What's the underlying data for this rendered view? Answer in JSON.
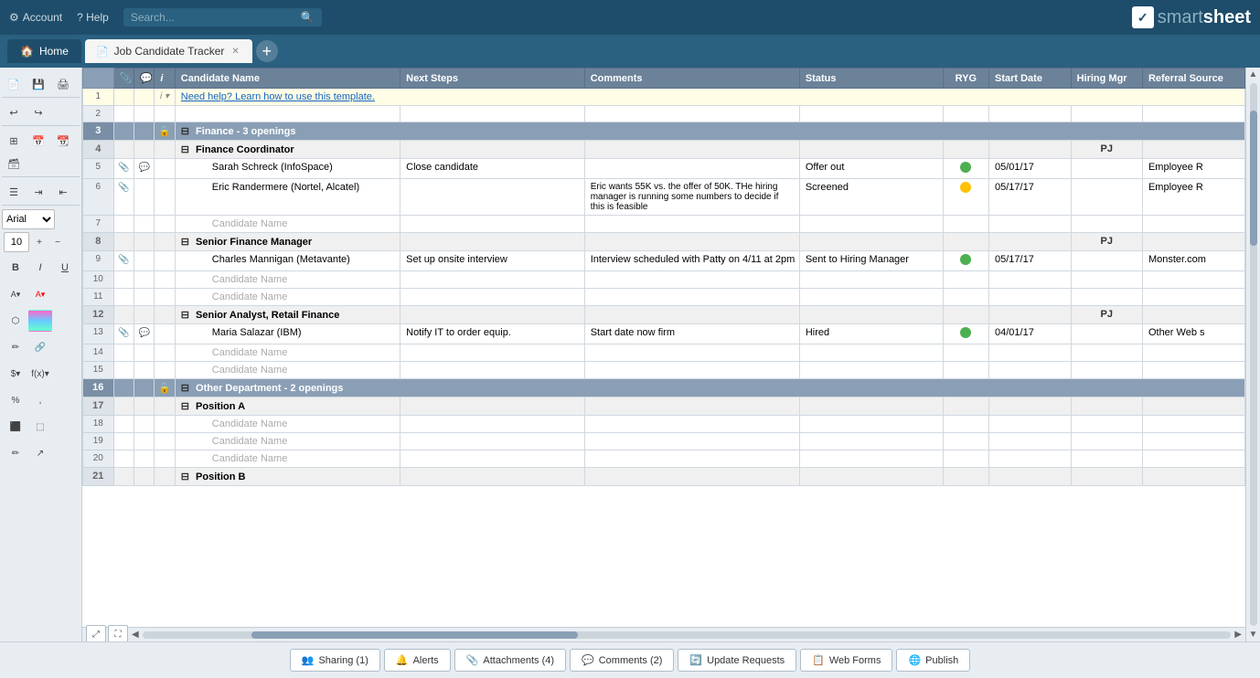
{
  "topnav": {
    "account_label": "Account",
    "help_label": "? Help",
    "search_placeholder": "Search...",
    "logo_smart": "smart",
    "logo_sheet": "sheet"
  },
  "tabs": {
    "home_label": "Home",
    "sheet_label": "Job Candidate Tracker",
    "add_label": "+"
  },
  "columns": {
    "candidate_name": "Candidate Name",
    "next_steps": "Next Steps",
    "comments": "Comments",
    "status": "Status",
    "ryg": "RYG",
    "start_date": "Start Date",
    "hiring_mgr": "Hiring Mgr",
    "referral_source": "Referral Source"
  },
  "info_bar": {
    "text": "Need help? Learn how to use this template."
  },
  "rows": [
    {
      "num": 1,
      "type": "info"
    },
    {
      "num": 2,
      "type": "empty"
    },
    {
      "num": 3,
      "type": "section",
      "has_lock": true,
      "label": "Finance - 3 openings"
    },
    {
      "num": 4,
      "type": "subsection",
      "label": "Finance Coordinator",
      "pj": "PJ"
    },
    {
      "num": 5,
      "type": "data",
      "has_attach": true,
      "has_comment": true,
      "candidate": "Sarah Schreck (InfoSpace)",
      "next_steps": "Close candidate",
      "comments": "",
      "status": "Offer out",
      "ryg": "green",
      "start_date": "05/01/17",
      "hiring_mgr": "",
      "referral": "Employee R"
    },
    {
      "num": 6,
      "type": "data",
      "has_attach": true,
      "has_comment": false,
      "candidate": "Eric Randermere (Nortel, Alcatel)",
      "next_steps": "",
      "comments": "Eric wants 55K vs. the offer of 50K. THe hiring manager is running some numbers to decide if this is feasible",
      "status": "Screened",
      "ryg": "yellow",
      "start_date": "05/17/17",
      "hiring_mgr": "",
      "referral": "Employee R"
    },
    {
      "num": 7,
      "type": "data",
      "has_attach": false,
      "has_comment": false,
      "candidate": "Candidate Name",
      "next_steps": "",
      "comments": "",
      "status": "",
      "ryg": "",
      "start_date": "",
      "hiring_mgr": "",
      "referral": ""
    },
    {
      "num": 8,
      "type": "subsection",
      "label": "Senior Finance Manager",
      "pj": "PJ"
    },
    {
      "num": 9,
      "type": "data",
      "has_attach": true,
      "has_comment": false,
      "candidate": "Charles Mannigan (Metavante)",
      "next_steps": "Set up onsite interview",
      "comments": "Interview scheduled with Patty on 4/11 at 2pm",
      "status": "Sent to Hiring Manager",
      "ryg": "green",
      "start_date": "05/17/17",
      "hiring_mgr": "",
      "referral": "Monster.com"
    },
    {
      "num": 10,
      "type": "data",
      "has_attach": false,
      "has_comment": false,
      "candidate": "Candidate Name",
      "next_steps": "",
      "comments": "",
      "status": "",
      "ryg": "",
      "start_date": "",
      "hiring_mgr": "",
      "referral": ""
    },
    {
      "num": 11,
      "type": "data",
      "has_attach": false,
      "has_comment": false,
      "candidate": "Candidate Name",
      "next_steps": "",
      "comments": "",
      "status": "",
      "ryg": "",
      "start_date": "",
      "hiring_mgr": "",
      "referral": ""
    },
    {
      "num": 12,
      "type": "subsection",
      "label": "Senior Analyst, Retail Finance",
      "pj": "PJ"
    },
    {
      "num": 13,
      "type": "data",
      "has_attach": true,
      "has_comment": true,
      "candidate": "Maria Salazar (IBM)",
      "next_steps": "Notify IT to order equip.",
      "comments": "Start date now firm",
      "status": "Hired",
      "ryg": "green",
      "start_date": "04/01/17",
      "hiring_mgr": "",
      "referral": "Other Web s"
    },
    {
      "num": 14,
      "type": "data",
      "has_attach": false,
      "has_comment": false,
      "candidate": "Candidate Name",
      "next_steps": "",
      "comments": "",
      "status": "",
      "ryg": "",
      "start_date": "",
      "hiring_mgr": "",
      "referral": ""
    },
    {
      "num": 15,
      "type": "data",
      "has_attach": false,
      "has_comment": false,
      "candidate": "Candidate Name",
      "next_steps": "",
      "comments": "",
      "status": "",
      "ryg": "",
      "start_date": "",
      "hiring_mgr": "",
      "referral": ""
    },
    {
      "num": 16,
      "type": "section",
      "has_lock": true,
      "label": "Other Department - 2 openings"
    },
    {
      "num": 17,
      "type": "subsection",
      "label": "Position A",
      "pj": ""
    },
    {
      "num": 18,
      "type": "data",
      "has_attach": false,
      "has_comment": false,
      "candidate": "Candidate Name",
      "next_steps": "",
      "comments": "",
      "status": "",
      "ryg": "",
      "start_date": "",
      "hiring_mgr": "",
      "referral": ""
    },
    {
      "num": 19,
      "type": "data",
      "has_attach": false,
      "has_comment": false,
      "candidate": "Candidate Name",
      "next_steps": "",
      "comments": "",
      "status": "",
      "ryg": "",
      "start_date": "",
      "hiring_mgr": "",
      "referral": ""
    },
    {
      "num": 20,
      "type": "data",
      "has_attach": false,
      "has_comment": false,
      "candidate": "Candidate Name",
      "next_steps": "",
      "comments": "",
      "status": "",
      "ryg": "",
      "start_date": "",
      "hiring_mgr": "",
      "referral": ""
    },
    {
      "num": 21,
      "type": "subsection_partial",
      "label": "Position B",
      "pj": ""
    }
  ],
  "bottom_buttons": [
    {
      "id": "sharing",
      "icon": "👥",
      "label": "Sharing (1)"
    },
    {
      "id": "alerts",
      "icon": "🔔",
      "label": "Alerts"
    },
    {
      "id": "attachments",
      "icon": "📎",
      "label": "Attachments (4)"
    },
    {
      "id": "comments",
      "icon": "💬",
      "label": "Comments (2)"
    },
    {
      "id": "update_requests",
      "icon": "🔄",
      "label": "Update Requests"
    },
    {
      "id": "web_forms",
      "icon": "📋",
      "label": "Web Forms"
    },
    {
      "id": "publish",
      "icon": "🌐",
      "label": "Publish"
    }
  ]
}
